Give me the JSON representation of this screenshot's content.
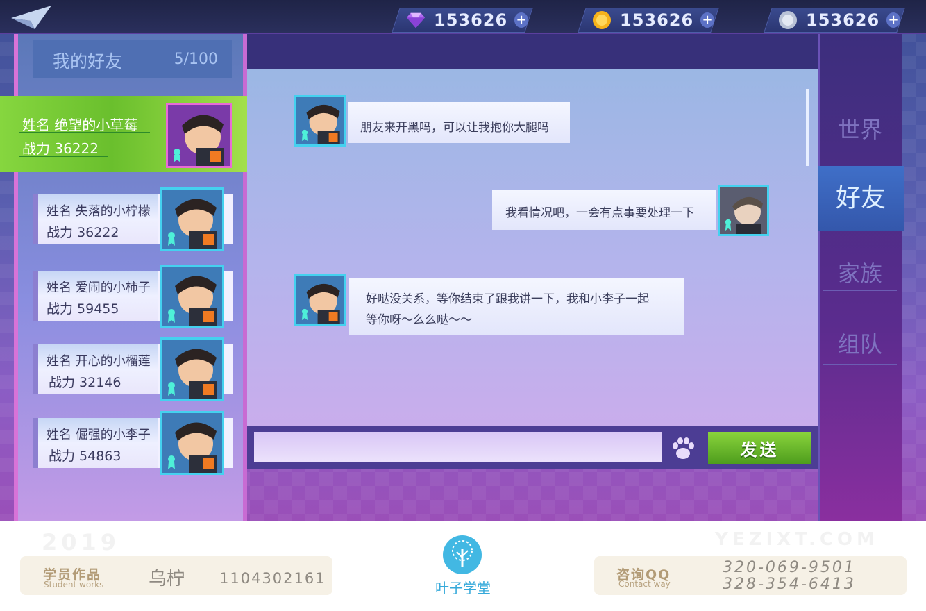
{
  "topbar": {
    "currencies": [
      {
        "icon": "diamond-icon",
        "value": "153626",
        "plus": "+"
      },
      {
        "icon": "gold-coin-icon",
        "value": "153626",
        "plus": "+"
      },
      {
        "icon": "silver-coin-icon",
        "value": "153626",
        "plus": "+"
      }
    ]
  },
  "friends": {
    "title": "我的好友",
    "count": "5/100",
    "selected": {
      "name_line": "姓名  绝望的小草莓",
      "power_line": "战力  36222"
    },
    "items": [
      {
        "name_line": "姓名  失落的小柠檬",
        "power_line": "战力  36222"
      },
      {
        "name_line": "姓名  爱闹的小柿子",
        "power_line": "战力  59455"
      },
      {
        "name_line": "姓名  开心的小榴莲",
        "power_line": "战力  32146"
      },
      {
        "name_line": "姓名  倔强的小李子",
        "power_line": "战力  54863"
      }
    ]
  },
  "chat": {
    "messages": [
      {
        "side": "left",
        "text": "朋友来开黑吗，可以让我抱你大腿吗"
      },
      {
        "side": "right",
        "text": "我看情况吧，一会有点事要处理一下"
      },
      {
        "side": "left",
        "line1": "好哒没关系，等你结束了跟我讲一下，我和小李子一起",
        "line2": "等你呀～么么哒～～"
      }
    ],
    "input_value": "",
    "send_label": "发送"
  },
  "tabs": {
    "world": "世界",
    "friends": "好友",
    "family": "家族",
    "team": "组队"
  },
  "footer": {
    "watermark_year": "2019",
    "watermark_site": "YEZIXT.COM",
    "works_label": "学员作品",
    "works_label_en": "Student works",
    "student_name": "乌柠",
    "student_id": "1104302161",
    "logo_text": "叶子学堂",
    "qq_label": "咨询QQ",
    "qq_label_en": "Contact way",
    "qq_1": "320-069-9501",
    "qq_2": "328-354-6413"
  },
  "colors": {
    "accent_green": "#7cc934",
    "accent_blue": "#3f6fc8",
    "panel_purple": "#4c3d94"
  }
}
